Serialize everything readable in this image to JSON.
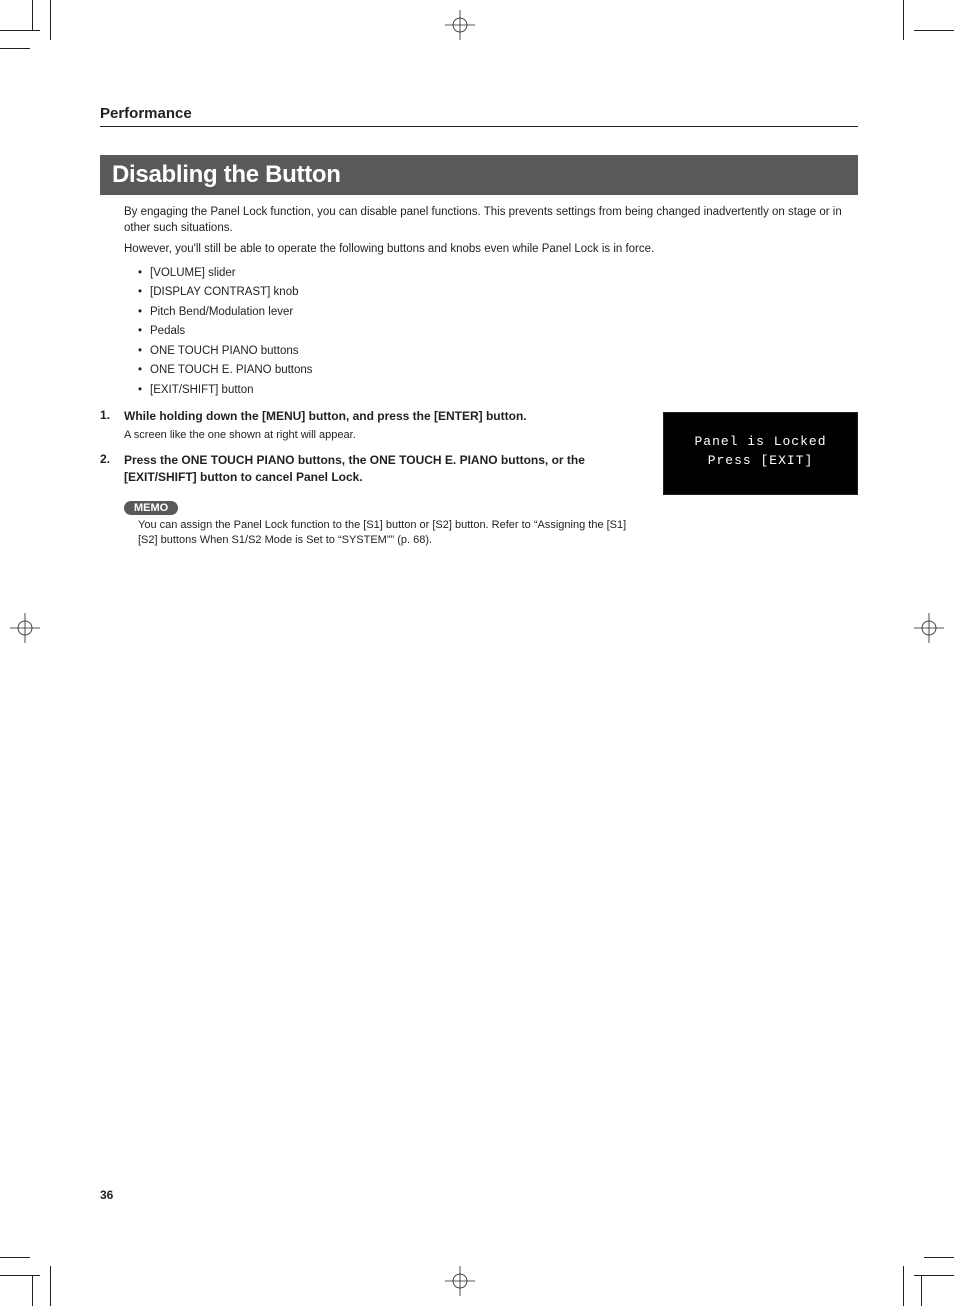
{
  "header": {
    "section": "Performance"
  },
  "title": "Disabling the Button",
  "intro": [
    "By engaging the Panel Lock function, you can disable panel functions. This prevents settings from being changed inadvertently on stage or in other such situations.",
    "However, you'll still be able to operate the following buttons and knobs even while Panel Lock is in force."
  ],
  "bullets": [
    "[VOLUME] slider",
    "[DISPLAY CONTRAST] knob",
    "Pitch Bend/Modulation lever",
    "Pedals",
    "ONE TOUCH PIANO buttons",
    "ONE TOUCH E. PIANO buttons",
    "[EXIT/SHIFT] button"
  ],
  "steps": [
    {
      "title": "While holding down the [MENU] button, and press the [ENTER] button.",
      "body": "A screen like the one shown at right will appear."
    },
    {
      "title": "Press the ONE TOUCH PIANO buttons, the ONE TOUCH E. PIANO buttons, or the [EXIT/SHIFT] button to cancel Panel Lock.",
      "body": ""
    }
  ],
  "memo": {
    "label": "MEMO",
    "text": "You can assign the Panel Lock function to the [S1] button or [S2] button. Refer to “Assigning the [S1] [S2] buttons When S1/S2 Mode is Set to “SYSTEM”” (p. 68)."
  },
  "lcd": {
    "line1": "Panel is Locked",
    "line2": "Press [EXIT]"
  },
  "page_number": "36"
}
